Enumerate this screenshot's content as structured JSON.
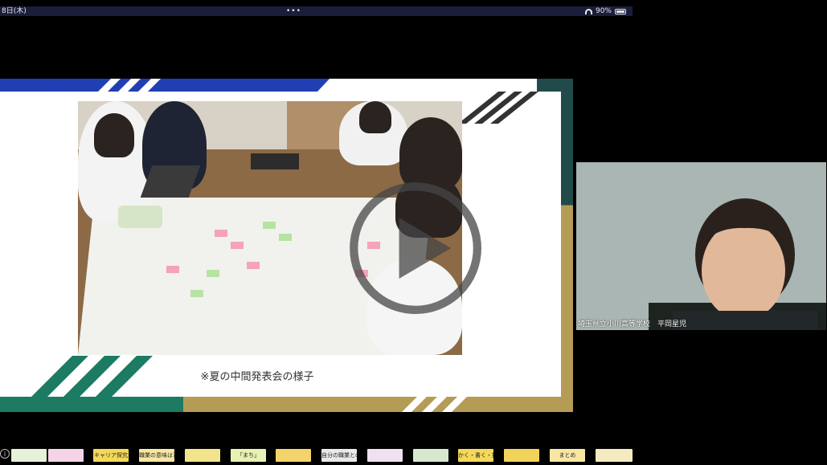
{
  "status_bar": {
    "time": "8日(木)",
    "dots": "•••",
    "battery": "90%"
  },
  "slide": {
    "caption": "※夏の中間発表会の様子"
  },
  "participant": {
    "name_label": "埼玉県立小川高等学校　平岡星児"
  },
  "thumbnails": [
    {
      "label": "",
      "color": "#e7f0d9"
    },
    {
      "label": "",
      "color": "#f5d4e8"
    },
    {
      "label": "キャリア探究",
      "color": "#f3d85a"
    },
    {
      "label": "職業の意味は？",
      "color": "#f7e7a3"
    },
    {
      "label": "",
      "color": "#f2e48a"
    },
    {
      "label": "「まち」",
      "color": "#e9f0b3"
    },
    {
      "label": "",
      "color": "#f5d36b"
    },
    {
      "label": "自分の職業とのつながりを考える",
      "color": "#e9e9e9"
    },
    {
      "label": "",
      "color": "#f0e0f0"
    },
    {
      "label": "",
      "color": "#d8e8d0"
    },
    {
      "label": "かく・書く・描く",
      "color": "#f3d85a"
    },
    {
      "label": "",
      "color": "#f1d35a"
    },
    {
      "label": "まとめ",
      "color": "#f7e7a3"
    },
    {
      "label": "",
      "color": "#f4ecc0"
    }
  ]
}
